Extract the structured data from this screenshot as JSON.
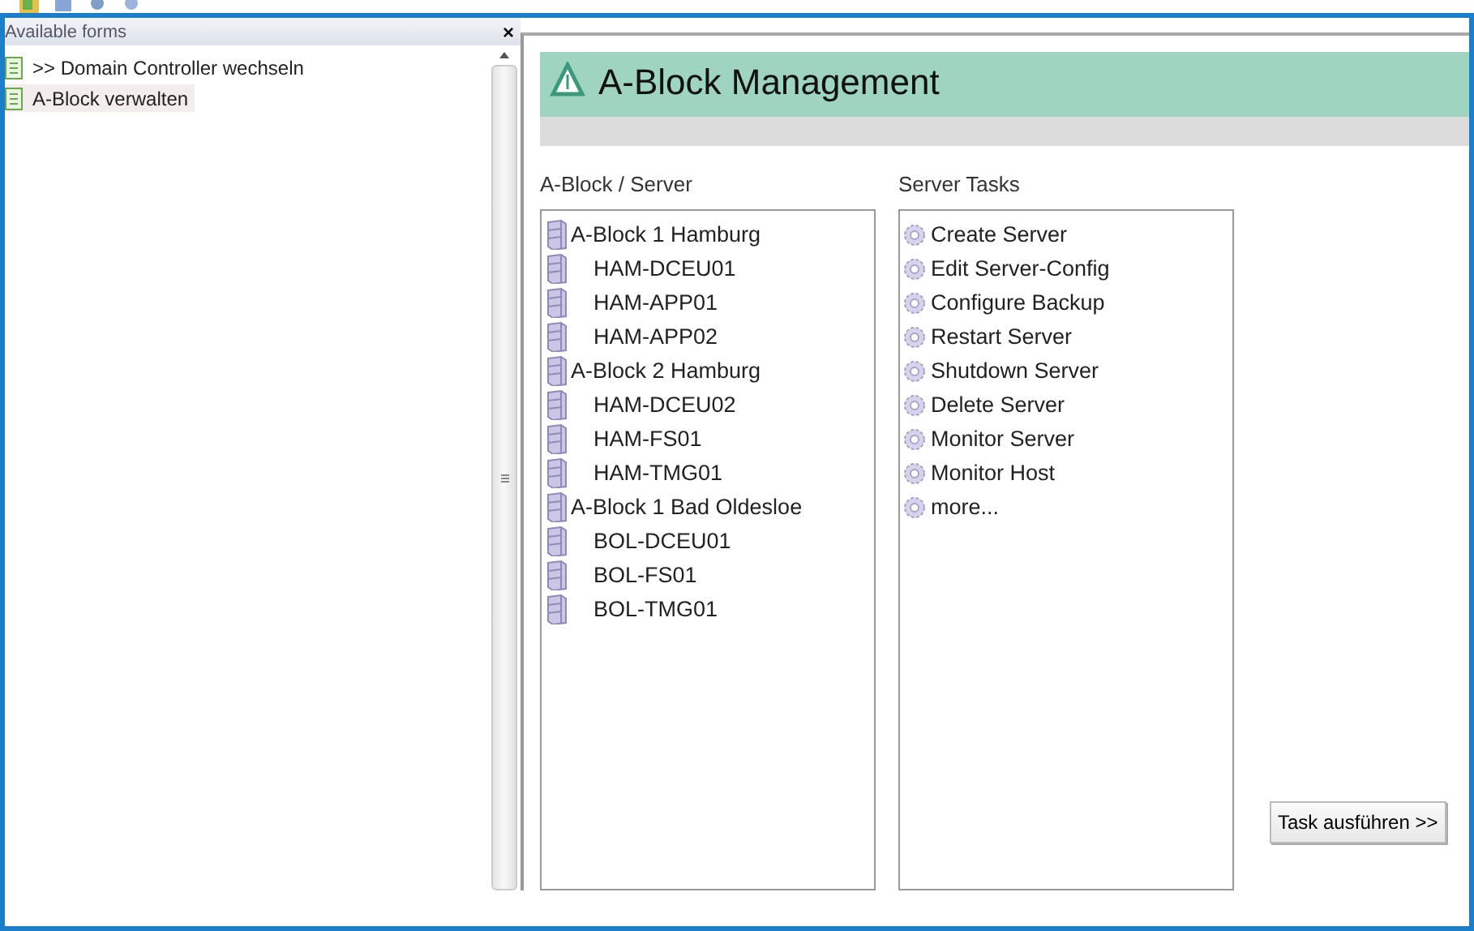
{
  "forms_panel": {
    "title": "Available forms",
    "close": "×",
    "items": [
      {
        "label": ">> Domain Controller wechseln",
        "selected": false
      },
      {
        "label": "A-Block verwalten",
        "selected": true
      }
    ]
  },
  "header": {
    "title": "A-Block Management"
  },
  "server_list": {
    "label": "A-Block / Server",
    "items": [
      {
        "label": "A-Block 1 Hamburg",
        "children": [
          {
            "label": "HAM-DCEU01"
          },
          {
            "label": "HAM-APP01"
          },
          {
            "label": "HAM-APP02"
          }
        ]
      },
      {
        "label": "A-Block 2 Hamburg",
        "children": [
          {
            "label": "HAM-DCEU02"
          },
          {
            "label": "HAM-FS01"
          },
          {
            "label": "HAM-TMG01"
          }
        ]
      },
      {
        "label": "A-Block 1 Bad Oldesloe",
        "children": [
          {
            "label": "BOL-DCEU01"
          },
          {
            "label": "BOL-FS01"
          },
          {
            "label": "BOL-TMG01"
          }
        ]
      }
    ]
  },
  "task_list": {
    "label": "Server Tasks",
    "items": [
      "Create Server",
      "Edit Server-Config",
      "Configure Backup",
      "Restart Server",
      "Shutdown Server",
      "Delete Server",
      "Monitor Server",
      "Monitor Host",
      "more..."
    ]
  },
  "run_button": "Task ausführen >>"
}
